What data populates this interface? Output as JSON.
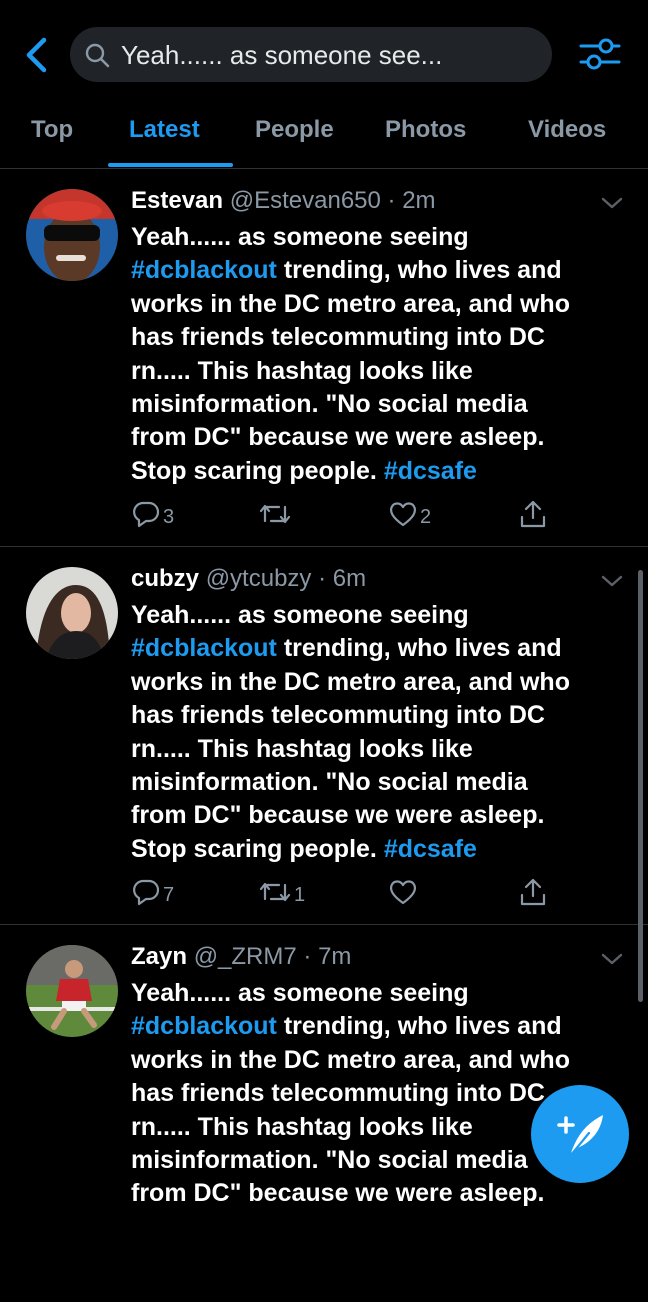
{
  "search": {
    "query": "Yeah...... as someone see..."
  },
  "tabs": [
    {
      "label": "Top"
    },
    {
      "label": "Latest"
    },
    {
      "label": "People"
    },
    {
      "label": "Photos"
    },
    {
      "label": "Videos"
    }
  ],
  "active_tab": "Latest",
  "colors": {
    "accent": "#1d9bf0",
    "background": "#000000",
    "muted": "#8b98a5"
  },
  "tweets": [
    {
      "name": "Estevan",
      "handle": "@Estevan650",
      "time": "2m",
      "lines": [
        "Yeah...... as someone seeing",
        "#dcblackout",
        " trending, who lives and",
        "works in the DC metro area, and who",
        "has friends telecommuting into DC",
        "rn..... This hashtag looks like",
        "misinformation. \"No social media",
        "from DC\" because we were asleep.",
        "Stop scaring people. ",
        "#dcsafe"
      ],
      "replies": "3",
      "retweets": "",
      "likes": "2"
    },
    {
      "name": "cubzy",
      "handle": "@ytcubzy",
      "time": "6m",
      "lines": [
        "Yeah...... as someone seeing",
        "#dcblackout",
        " trending, who lives and",
        "works in the DC metro area, and who",
        "has friends telecommuting into DC",
        "rn..... This hashtag looks like",
        "misinformation. \"No social media",
        "from DC\" because we were asleep.",
        "Stop scaring people. ",
        "#dcsafe"
      ],
      "replies": "7",
      "retweets": "1",
      "likes": ""
    },
    {
      "name": "Zayn",
      "handle": "@_ZRM7",
      "time": "7m",
      "lines": [
        "Yeah...... as someone seeing",
        "#dcblackout",
        " trending, who lives and",
        "works in the DC metro area, and who",
        "has friends telecommuting into DC",
        "rn..... This hashtag looks like",
        "misinformation. \"No social media",
        "from DC\" because we were asleep."
      ],
      "replies": "",
      "retweets": "",
      "likes": ""
    }
  ],
  "icons": {
    "back": "chevron-left-icon",
    "search": "search-icon",
    "filter": "filter-sliders-icon",
    "reply": "reply-bubble-icon",
    "retweet": "retweet-icon",
    "like": "heart-icon",
    "share": "share-icon",
    "compose": "compose-feather-icon"
  }
}
